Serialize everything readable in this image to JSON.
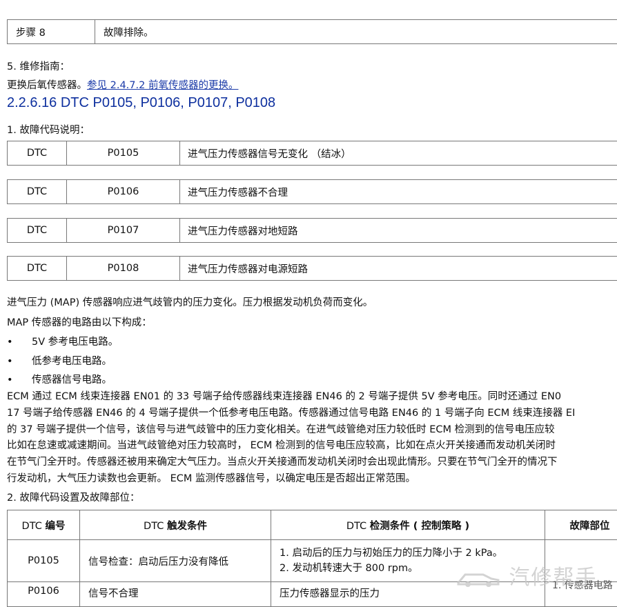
{
  "step_row": {
    "label": "步骤 8",
    "text": "故障排除。"
  },
  "section5": {
    "title": "5.  维修指南：",
    "body": "更换后氧传感器。",
    "link": "参见 2.4.7.2 前氧传感器的更换。"
  },
  "heading": "2.2.6.16 DTC P0105, P0106, P0107, P0108",
  "section1_title": "1.  故障代码说明：",
  "dtc_rows": [
    {
      "label": "DTC",
      "code": "P0105",
      "desc": "进气压力传感器信号无变化 （结冰）"
    },
    {
      "label": "DTC",
      "code": "P0106",
      "desc": "进气压力传感器不合理"
    },
    {
      "label": "DTC",
      "code": "P0107",
      "desc": "进气压力传感器对地短路"
    },
    {
      "label": "DTC",
      "code": "P0108",
      "desc": "进气压力传感器对电源短路"
    }
  ],
  "intro": [
    "进气压力 (MAP) 传感器响应进气歧管内的压力变化。压力根据发动机负荷而变化。",
    "MAP 传感器的电路由以下构成："
  ],
  "bullets": [
    "5V 参考电压电路。",
    "低参考电压电路。",
    "传感器信号电路。"
  ],
  "bullet_char": "•",
  "paragraph": [
    "ECM 通过 ECM 线束连接器 EN01 的 33 号端子给传感器线束连接器 EN46 的 2 号端子提供 5V 参考电压。同时还通过 EN0",
    "17 号端子给传感器 EN46 的 4 号端子提供一个低参考电压电路。传感器通过信号电路 EN46 的 1 号端子向 ECM 线束连接器 EI",
    "的 37 号端子提供一个信号，该信号与进气歧管中的压力变化相关。在进气歧管绝对压力较低时 ECM 检测到的信号电压应较",
    "比如在怠速或减速期间。当进气歧管绝对压力较高时， ECM 检测到的信号电压应较高，比如在点火开关接通而发动机关闭时",
    "在节气门全开时。传感器还被用来确定大气压力。当点火开关接通而发动机关闭时会出现此情形。只要在节气门全开的情况下",
    "行发动机，大气压力读数也会更新。 ECM 监测传感器信号，以确定电压是否超出正常范围。"
  ],
  "section2_title": "2.  故障代码设置及故障部位：",
  "fault_table": {
    "headers": {
      "col1_prefix": "DTC ",
      "col1_bold": "编号",
      "col2_prefix": "DTC ",
      "col2_bold": "触发条件",
      "col3_prefix": "DTC ",
      "col3_bold": "检测条件 ( 控制策略 )",
      "col4_bold": "故障部位"
    },
    "rows": [
      {
        "code": "P0105",
        "trigger": "信号检查：启动后压力没有降低",
        "conditions": [
          "1.   启动后的压力与初始压力的压力降小于 2 kPa。",
          "2.   发动机转速大于 800 rpm。"
        ],
        "location": ""
      },
      {
        "code": "P0106",
        "trigger": "信号不合理",
        "conditions": [
          "压力传感器显示的压力"
        ],
        "location": ""
      }
    ]
  },
  "side_note": "1.  传感器电路",
  "watermark": "汽修帮手"
}
